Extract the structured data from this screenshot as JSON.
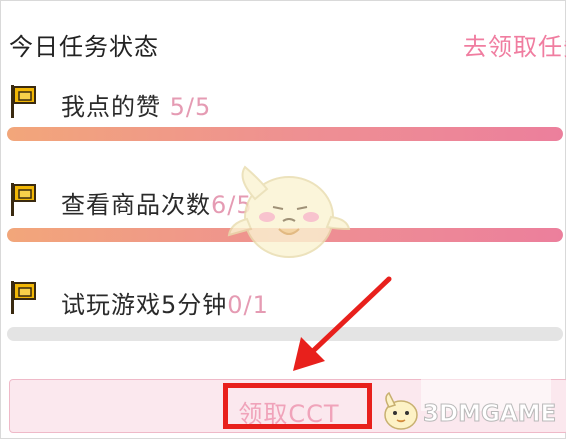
{
  "header": {
    "title": "今日任务状态",
    "link_label": "去领取任务"
  },
  "tasks": [
    {
      "label": "我点的赞",
      "progress": "5/5",
      "fill": 1.0
    },
    {
      "label": "查看商品次数",
      "progress": "6/5",
      "fill": 1.0
    },
    {
      "label": "试玩游戏5分钟",
      "progress": "0/1",
      "fill": 0.0
    }
  ],
  "claim_button": {
    "label": "领取CCT"
  },
  "watermark": {
    "text": "3DMGAME"
  },
  "colors": {
    "accent": "#f07da0",
    "progress_start": "#f2a67a",
    "progress_end": "#ec7f9c",
    "highlight": "#e8201c",
    "flag": "#f2b705"
  },
  "icons": {
    "task_flag": "flag-icon",
    "annotation_arrow": "arrow-icon",
    "watermark_logo": "watermark-logo-icon"
  }
}
